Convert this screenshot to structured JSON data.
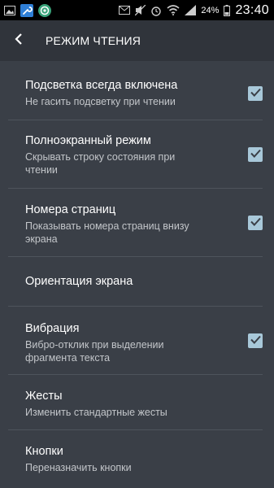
{
  "status_bar": {
    "battery": "24%",
    "time": "23:40"
  },
  "toolbar": {
    "title": "РЕЖИМ ЧТЕНИЯ"
  },
  "settings": [
    {
      "title": "Подсветка всегда включена",
      "subtitle": "Не гасить подсветку при чтении",
      "checked": true
    },
    {
      "title": "Полноэкранный режим",
      "subtitle": "Скрывать строку состояния при чтении",
      "checked": true
    },
    {
      "title": "Номера страниц",
      "subtitle": "Показывать номера страниц внизу экрана",
      "checked": true
    },
    {
      "title": "Ориентация экрана",
      "subtitle": "",
      "checked": null
    },
    {
      "title": "Вибрация",
      "subtitle": "Вибро-отклик при выделении фрагмента текста",
      "checked": true
    },
    {
      "title": "Жесты",
      "subtitle": "Изменить стандартные жесты",
      "checked": null
    },
    {
      "title": "Кнопки",
      "subtitle": "Переназначить кнопки",
      "checked": null
    }
  ]
}
